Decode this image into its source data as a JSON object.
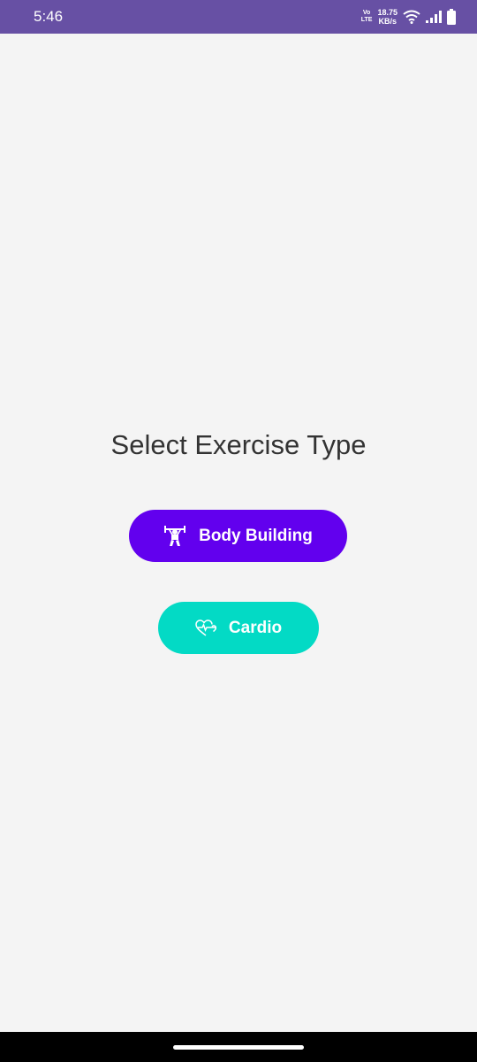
{
  "status_bar": {
    "time": "5:46",
    "volte_top": "Vo",
    "volte_bottom": "LTE",
    "speed_value": "18.75",
    "speed_unit": "KB/s",
    "background": "#6750a4"
  },
  "main": {
    "title": "Select Exercise Type",
    "buttons": [
      {
        "label": "Body Building",
        "icon": "weightlifting-icon",
        "color": "#6200ee"
      },
      {
        "label": "Cardio",
        "icon": "heartbeat-icon",
        "color": "#03dac5"
      }
    ]
  }
}
